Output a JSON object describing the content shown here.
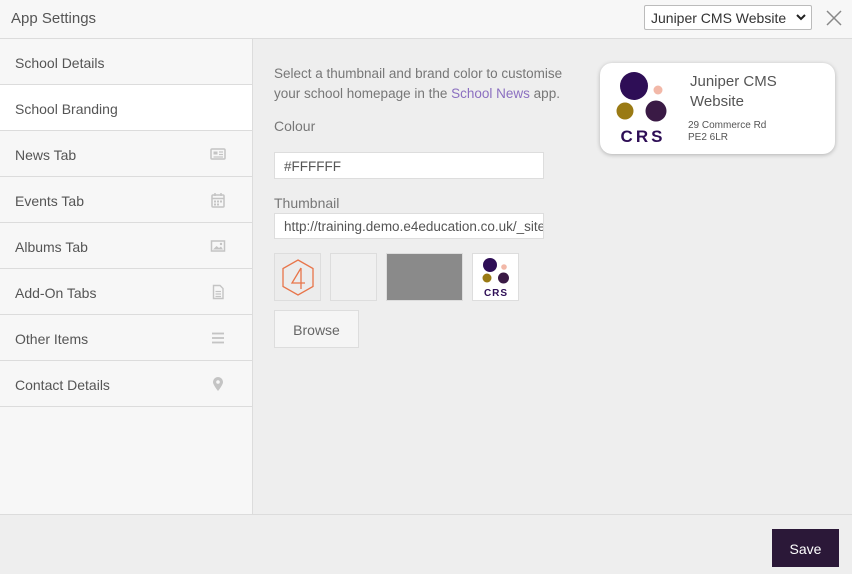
{
  "window": {
    "title": "App Settings"
  },
  "site_select": {
    "selected": "Juniper CMS Website"
  },
  "sidebar": {
    "items": [
      {
        "label": "School Details",
        "icon": ""
      },
      {
        "label": "School Branding",
        "icon": "",
        "active": true
      },
      {
        "label": "News Tab",
        "icon": "newspaper-icon"
      },
      {
        "label": "Events Tab",
        "icon": "calendar-icon"
      },
      {
        "label": "Albums Tab",
        "icon": "image-icon"
      },
      {
        "label": "Add-On Tabs",
        "icon": "document-icon"
      },
      {
        "label": "Other Items",
        "icon": "list-icon"
      },
      {
        "label": "Contact Details",
        "icon": "map-pin-icon"
      }
    ]
  },
  "branding": {
    "intro_before": "Select a thumbnail and brand color to customise your school homepage in the ",
    "intro_link": "School News",
    "intro_after": " app.",
    "colour_label": "Colour",
    "colour_value": "#FFFFFF",
    "thumbnail_label": "Thumbnail",
    "thumbnail_value": "http://training.demo.e4education.co.uk/_site/",
    "browse_label": "Browse"
  },
  "preview": {
    "name": "Juniper CMS Website",
    "address_line1": "29 Commerce Rd",
    "address_line2": "PE2 6LR",
    "logo_text": "CRS"
  },
  "thumbs": [
    "e4-logo",
    "blank-light",
    "blank-gray",
    "crs-logo"
  ],
  "footer": {
    "save_label": "Save"
  },
  "colors": {
    "accent": "#2b1838",
    "link": "#8b6fc0",
    "logo_purple_dark": "#2e0e56",
    "logo_purple": "#3a1a45",
    "logo_gold": "#9a7a14",
    "logo_pink": "#f2b8a8",
    "e4_orange": "#e8754a"
  }
}
